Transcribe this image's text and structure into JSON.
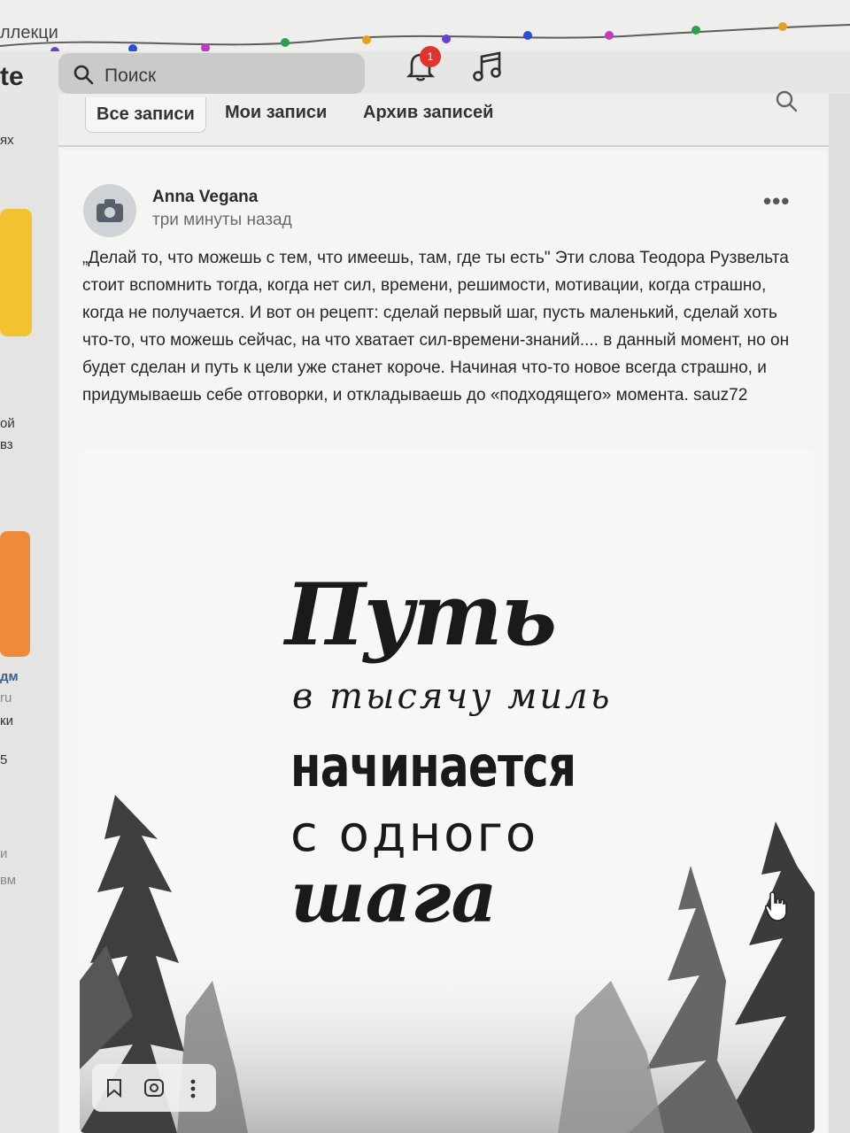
{
  "header": {
    "crumb": "ллекци",
    "logo_fragment": "te",
    "search_placeholder": "Поиск",
    "notification_count": "1"
  },
  "sidebar": {
    "snippets": [
      "ях",
      "ой",
      "вз",
      "дм",
      "ru",
      "ки",
      "5",
      "и",
      "вм"
    ]
  },
  "tabs": {
    "items": [
      "Все записи",
      "Мои записи",
      "Архив записей"
    ],
    "active": "Все записи"
  },
  "post": {
    "author": "Anna Vegana",
    "time": "три минуты назад",
    "text": "„Делай то, что можешь с тем, что имеешь, там, где ты есть\" Эти слова Теодора Рузвельта стоит вспомнить тогда, когда нет сил, времени, решимости, мотивации, когда страшно, когда не получается. И вот он рецепт: сделай первый шаг, пусть маленький, сделай хоть что-то, что можешь сейчас, на что хватает сил-времени-знаний.... в данный момент, но он будет сделан и путь к цели уже станет короче. Начиная что-то новое всегда страшно, и придумываешь себе отговорки, и откладываешь до «подходящего» момента. sauz72",
    "image_quote": {
      "line1": "Путь",
      "line2": "в тысячу миль",
      "line3": "начинается",
      "line4": "с одного",
      "line5": "шага"
    }
  },
  "icons": [
    "search-icon",
    "bell-icon",
    "music-icon",
    "camera-icon",
    "more-icon",
    "bookmark-icon",
    "lens-icon",
    "kebab-icon",
    "hand-cursor-icon"
  ]
}
